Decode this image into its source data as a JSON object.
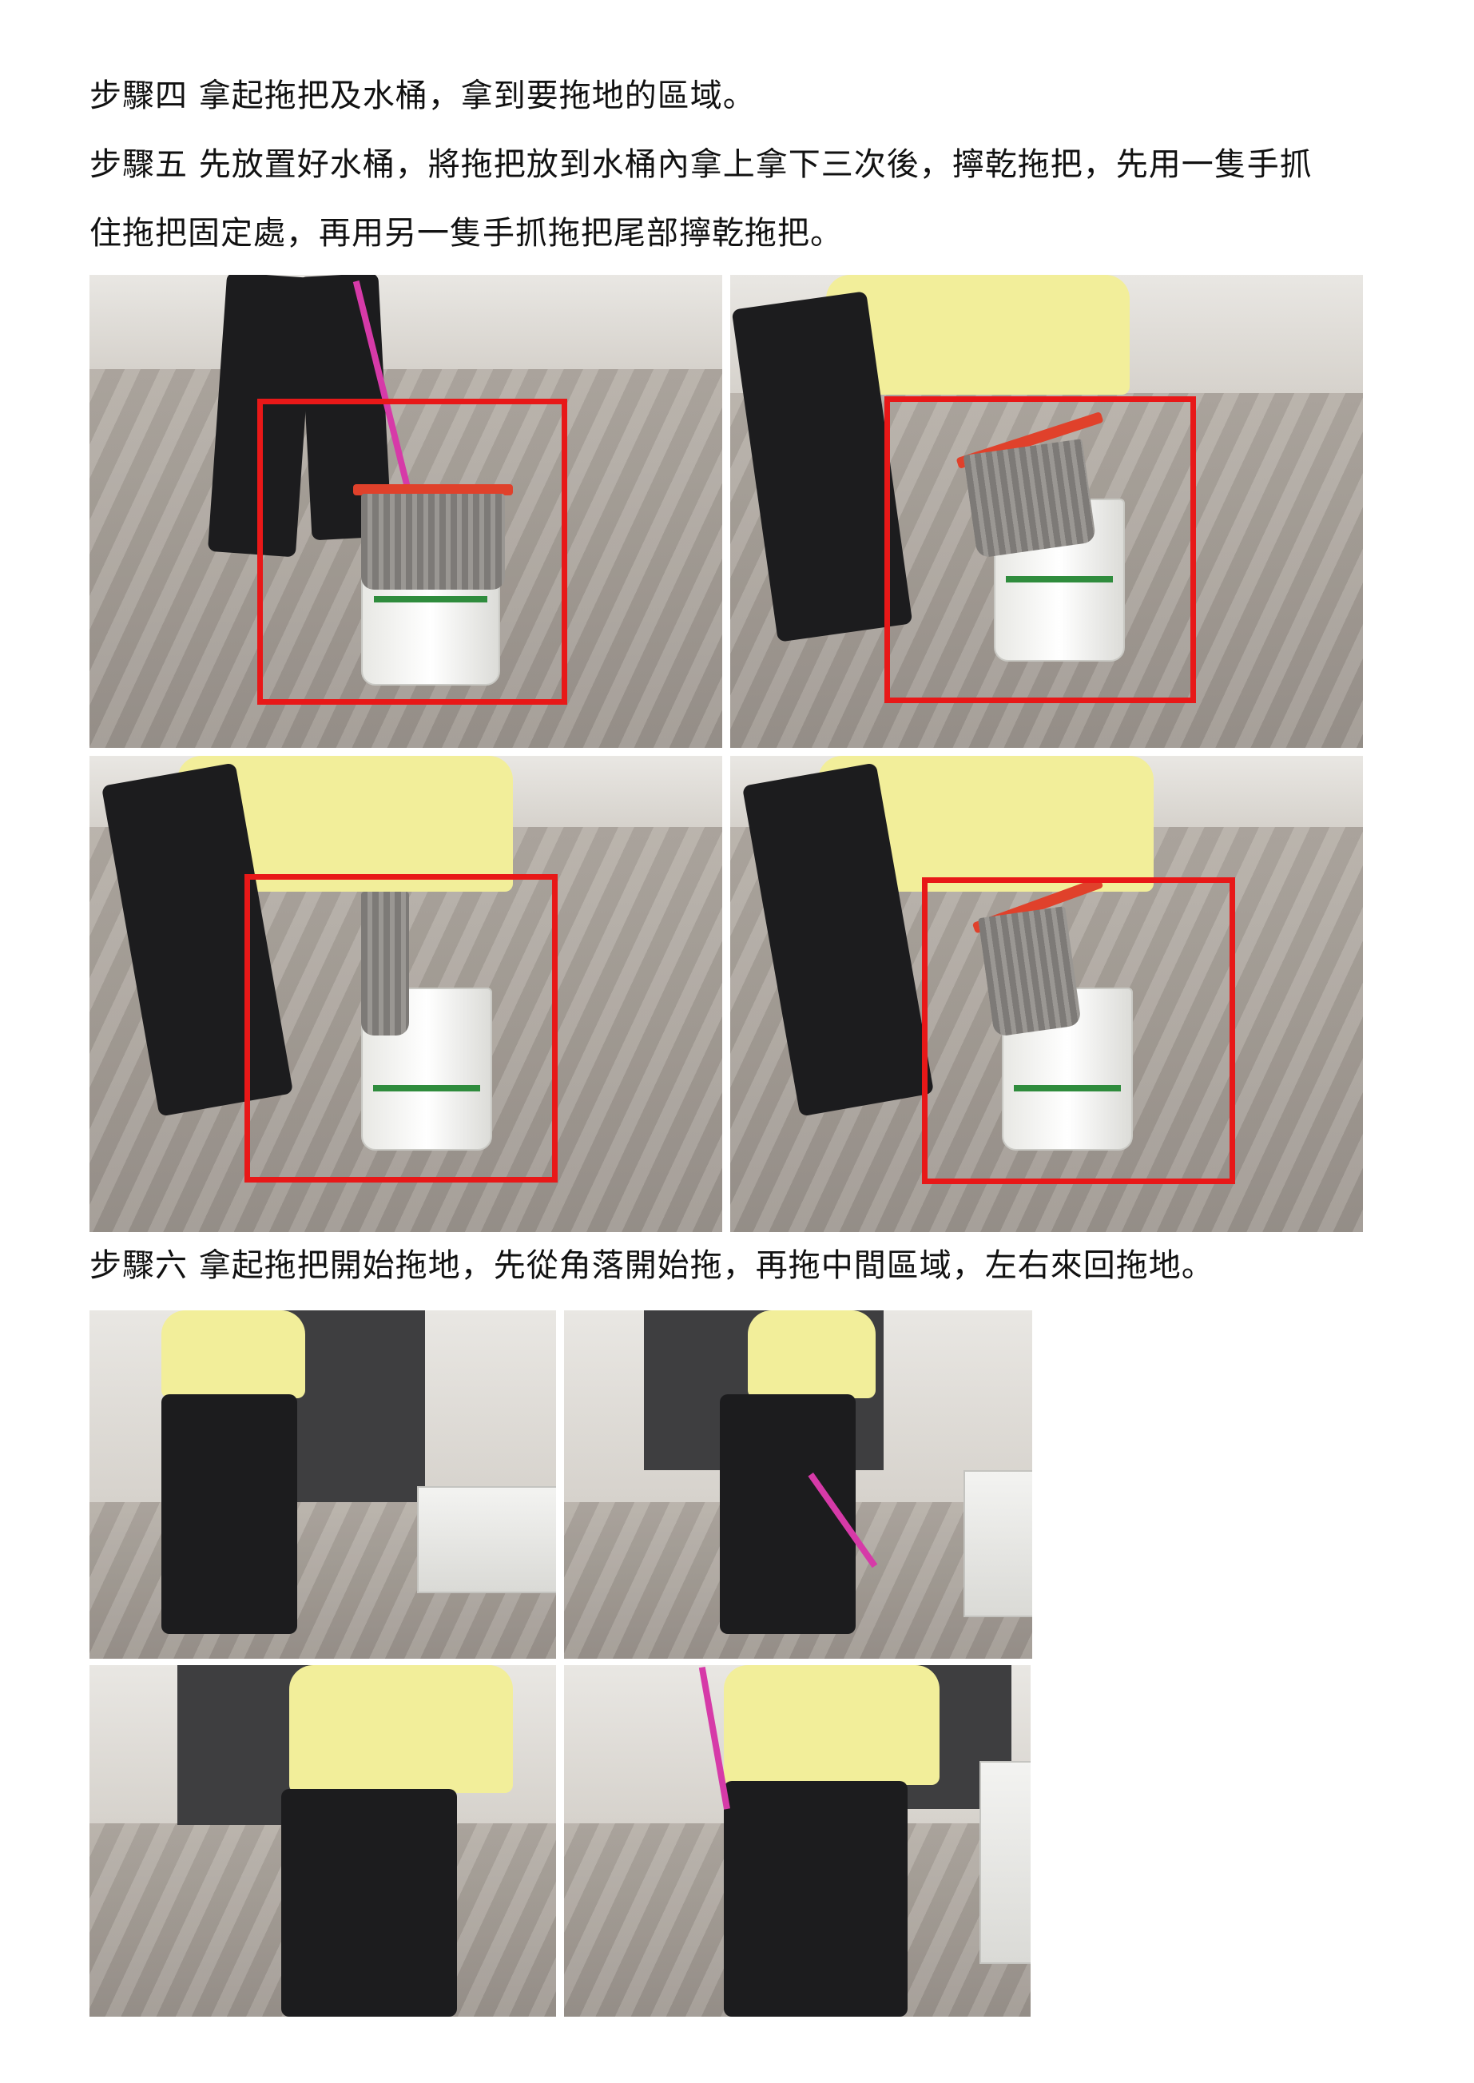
{
  "text_lines": [
    "步驟四 拿起拖把及水桶，拿到要拖地的區域。",
    "步驟五 先放置好水桶，將拖把放到水桶內拿上拿下三次後，擰乾拖把，先用一隻手抓",
    "住拖把固定處，再用另一隻手抓拖把尾部擰乾拖把。",
    "步驟六 拿起拖把開始拖地，先從角落開始拖，再拖中間區域，左右來回拖地。"
  ],
  "colors": {
    "highlight_box": "#e81818",
    "shirt": "#f2ee9a",
    "mop_head": "#e0412b",
    "handle": "#d63aa8"
  }
}
